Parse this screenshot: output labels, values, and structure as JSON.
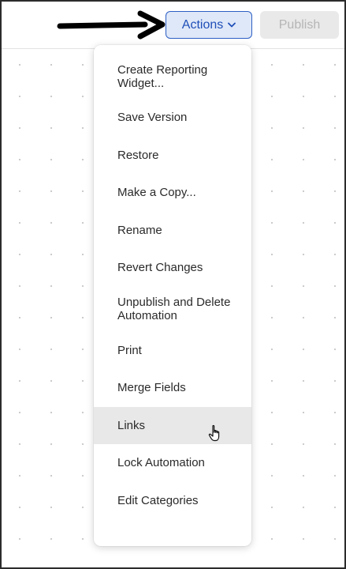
{
  "toolbar": {
    "actions_label": "Actions",
    "publish_label": "Publish"
  },
  "menu": {
    "items": [
      {
        "label": "Create Reporting Widget..."
      },
      {
        "label": "Save Version"
      },
      {
        "label": "Restore"
      },
      {
        "label": "Make a Copy..."
      },
      {
        "label": "Rename"
      },
      {
        "label": "Revert Changes"
      },
      {
        "label": "Unpublish and Delete Automation"
      },
      {
        "label": "Print"
      },
      {
        "label": "Merge Fields"
      },
      {
        "label": "Links"
      },
      {
        "label": "Lock Automation"
      },
      {
        "label": "Edit Categories"
      }
    ],
    "hovered_item": "Links"
  },
  "colors": {
    "accent": "#1f4fb8",
    "actions_bg": "#dfe8f8",
    "hover_bg": "#e8e8e8",
    "publish_disabled_bg": "#e9e9e9",
    "annotation_arrow": "#000000"
  },
  "icons": {
    "actions_dropdown": "chevron-down-icon",
    "annotation": "arrow-right-icon",
    "cursor": "hand-pointer-icon"
  }
}
